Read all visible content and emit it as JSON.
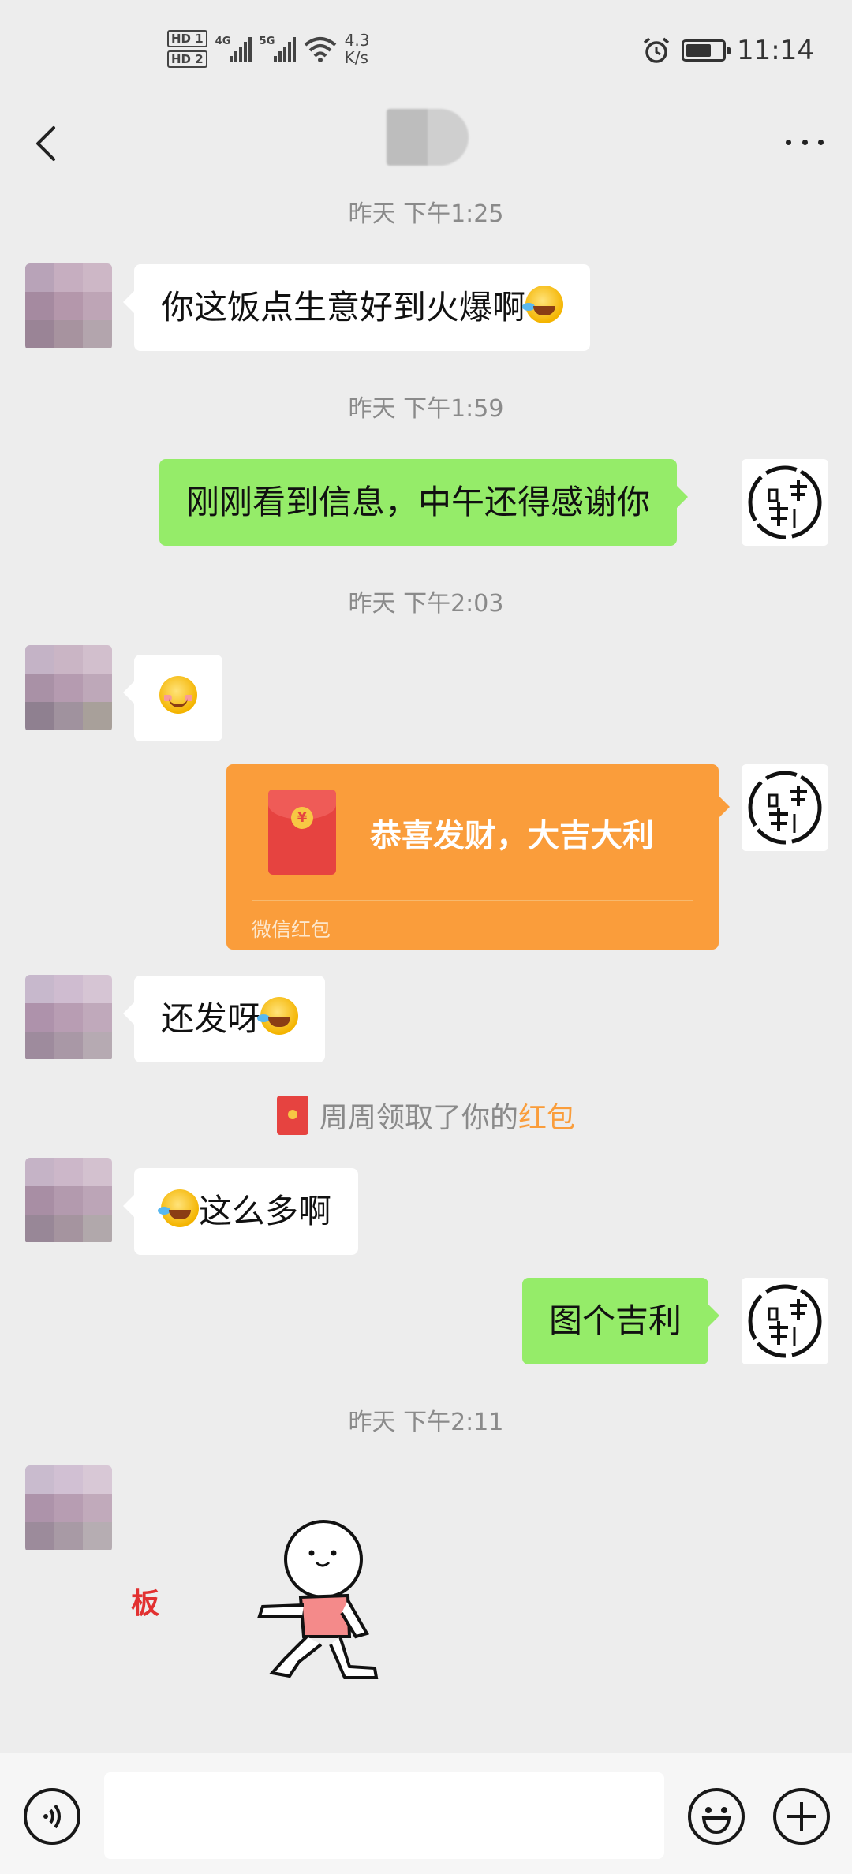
{
  "status_bar": {
    "hd1": "HD 1",
    "hd2": "HD 2",
    "net1": "4G",
    "net2": "5G",
    "speed_value": "4.3",
    "speed_unit": "K/s",
    "time": "11:14",
    "battery_level": 0.7
  },
  "nav": {
    "back_icon": "back-chevron-icon",
    "more_icon": "more-dots-icon"
  },
  "messages": {
    "t1": "昨天 下午1:25",
    "m1": "你这饭点生意好到火爆啊",
    "t2": "昨天 下午1:59",
    "m2": "刚刚看到信息，中午还得感谢你",
    "t3": "昨天 下午2:03",
    "packet_title": "恭喜发财，大吉大利",
    "packet_label": "微信红包",
    "m4": "还发呀",
    "sys_prefix": "周周领取了你的",
    "sys_link": "红包",
    "m5": "这么多啊",
    "m6": "图个吉利",
    "t4": "昨天 下午2:11",
    "red_text": "板"
  },
  "input_bar": {
    "voice_icon": "voice-icon",
    "emoji_icon": "emoji-icon",
    "plus_icon": "plus-icon",
    "placeholder": ""
  },
  "colors": {
    "background": "#ededed",
    "out_bubble": "#95ec69",
    "in_bubble": "#ffffff",
    "red_packet": "#fa9d3b",
    "link": "#fa9d3b"
  }
}
